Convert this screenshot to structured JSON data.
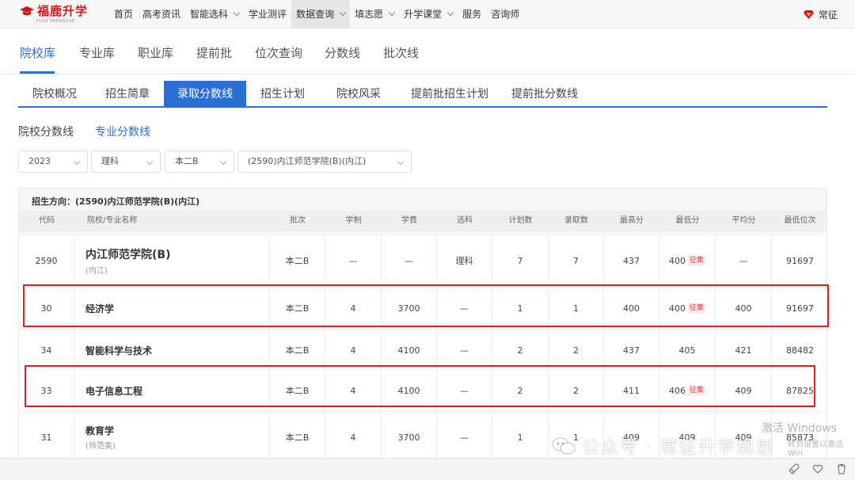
{
  "brand": {
    "name": "福鹿升学",
    "sub": "FULU SHENGXUE"
  },
  "topnav": [
    {
      "label": "首页",
      "dropdown": false,
      "active": false
    },
    {
      "label": "高考资讯",
      "dropdown": false,
      "active": false
    },
    {
      "label": "智能选科",
      "dropdown": true,
      "active": false
    },
    {
      "label": "学业测评",
      "dropdown": false,
      "active": false
    },
    {
      "label": "数据查询",
      "dropdown": true,
      "active": true
    },
    {
      "label": "填志愿",
      "dropdown": true,
      "active": false
    },
    {
      "label": "升学课堂",
      "dropdown": true,
      "active": false
    },
    {
      "label": "服务",
      "dropdown": false,
      "active": false
    },
    {
      "label": "咨询师",
      "dropdown": false,
      "active": false
    }
  ],
  "user": {
    "name": "常征",
    "icon": "gem-icon",
    "icon_color": "#d8141b"
  },
  "subnav": [
    "院校库",
    "专业库",
    "职业库",
    "提前批",
    "位次查询",
    "分数线",
    "批次线"
  ],
  "tabs": [
    "院校概况",
    "招生简章",
    "录取分数线",
    "招生计划",
    "院校风采",
    "提前批招生计划",
    "提前批分数线"
  ],
  "subtabs": [
    "院校分数线",
    "专业分数线"
  ],
  "filters": {
    "year": "2023",
    "subject": "理科",
    "batch": "本二B",
    "school": "(2590)内江师范学院(B)(内江)"
  },
  "table": {
    "direction": "招生方向：(2590)内江师范学院(B)(内江)",
    "headers": [
      "代码",
      "院校/专业名称",
      "批次",
      "学制",
      "学费",
      "选科",
      "计划数",
      "录取数",
      "最高分",
      "最低分",
      "平均分",
      "最低位次"
    ],
    "badge": "征集",
    "rows": [
      {
        "code": "2590",
        "name": "内江师范学院(B)",
        "sub": "(内江)",
        "batch": "本二B",
        "years": "—",
        "fee": "—",
        "subject": "理科",
        "plan": "7",
        "admit": "7",
        "max": "437",
        "min": "400",
        "min_badge": true,
        "avg": "—",
        "rank": "91697"
      },
      {
        "code": "30",
        "name": "经济学",
        "sub": "",
        "batch": "本二B",
        "years": "4",
        "fee": "3700",
        "subject": "—",
        "plan": "1",
        "admit": "1",
        "max": "400",
        "min": "400",
        "min_badge": true,
        "avg": "400",
        "rank": "91697"
      },
      {
        "code": "34",
        "name": "智能科学与技术",
        "sub": "",
        "batch": "本二B",
        "years": "4",
        "fee": "4100",
        "subject": "—",
        "plan": "2",
        "admit": "2",
        "max": "437",
        "min": "405",
        "min_badge": false,
        "avg": "421",
        "rank": "88482"
      },
      {
        "code": "33",
        "name": "电子信息工程",
        "sub": "",
        "batch": "本二B",
        "years": "4",
        "fee": "4100",
        "subject": "—",
        "plan": "2",
        "admit": "2",
        "max": "411",
        "min": "406",
        "min_badge": true,
        "avg": "409",
        "rank": "87825"
      },
      {
        "code": "31",
        "name": "教育学",
        "sub": "(师范类)",
        "batch": "本二B",
        "years": "4",
        "fee": "3700",
        "subject": "—",
        "plan": "1",
        "admit": "1",
        "max": "409",
        "min": "409",
        "min_badge": false,
        "avg": "409",
        "rank": "85873"
      }
    ]
  },
  "watermark": {
    "text": "公众号 · 常征升学规划",
    "windows_line1": "激活 Windows",
    "windows_line2": "转到设置以激活 Win"
  },
  "colors": {
    "accent": "#2a6fd6",
    "brand": "#d8141b",
    "highlight_box": "#e31c1c",
    "badge": "#e5413b"
  }
}
